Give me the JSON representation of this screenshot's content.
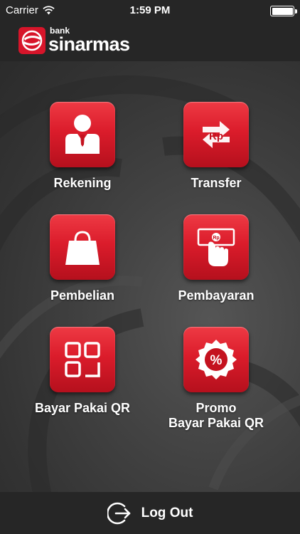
{
  "status_bar": {
    "carrier": "Carrier",
    "time": "1:59 PM"
  },
  "header": {
    "logo_small": "bank",
    "logo_big": "sinarmas"
  },
  "menu": {
    "items": [
      {
        "label": "Rekening",
        "icon": "person-icon"
      },
      {
        "label": "Transfer",
        "icon": "transfer-rp-icon",
        "icon_text": "Rp"
      },
      {
        "label": "Pembelian",
        "icon": "shopping-bag-icon"
      },
      {
        "label": "Pembayaran",
        "icon": "payment-hand-icon",
        "icon_text": "Rp"
      },
      {
        "label": "Bayar Pakai QR",
        "icon": "qr-scan-icon"
      },
      {
        "label_line1": "Promo",
        "label_line2": "Bayar Pakai QR",
        "icon": "percent-badge-icon",
        "icon_text": "%"
      }
    ]
  },
  "footer": {
    "logout_label": "Log Out",
    "icon": "logout-icon"
  },
  "colors": {
    "accent": "#d7152a",
    "bars": "#262626",
    "background": "#3a3a3a"
  }
}
